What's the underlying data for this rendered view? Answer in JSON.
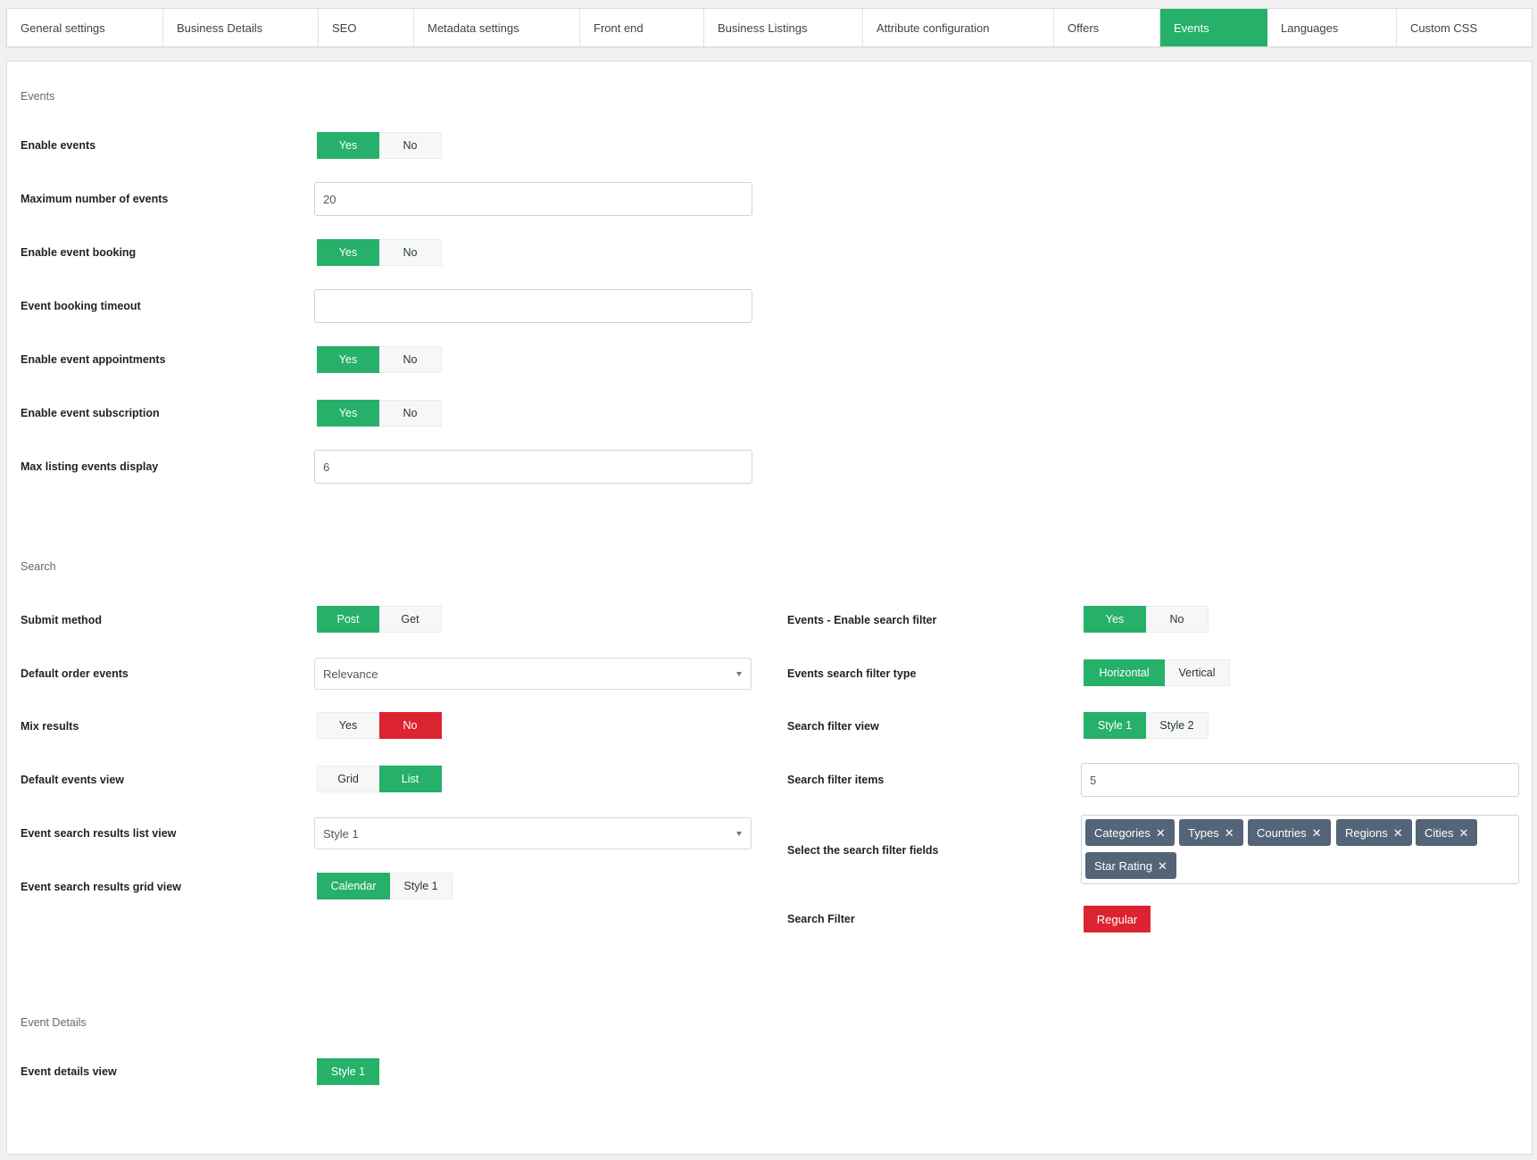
{
  "tabs": [
    {
      "label": "General settings"
    },
    {
      "label": "Business Details"
    },
    {
      "label": "SEO"
    },
    {
      "label": "Metadata settings"
    },
    {
      "label": "Front end"
    },
    {
      "label": "Business Listings"
    },
    {
      "label": "Attribute configuration"
    },
    {
      "label": "Offers"
    },
    {
      "label": "Events",
      "active": true
    },
    {
      "label": "Languages"
    },
    {
      "label": "Custom CSS"
    }
  ],
  "colors": {
    "accent": "#26b06a",
    "danger": "#dc2331",
    "tag": "#546578"
  },
  "events_section": {
    "title": "Events",
    "enable_events": {
      "label": "Enable events",
      "options": [
        "Yes",
        "No"
      ],
      "selected": "Yes"
    },
    "max_events": {
      "label": "Maximum number of events",
      "value": "20"
    },
    "enable_booking": {
      "label": "Enable event booking",
      "options": [
        "Yes",
        "No"
      ],
      "selected": "Yes"
    },
    "booking_timeout": {
      "label": "Event booking timeout",
      "value": ""
    },
    "enable_appointments": {
      "label": "Enable event appointments",
      "options": [
        "Yes",
        "No"
      ],
      "selected": "Yes"
    },
    "enable_subscription": {
      "label": "Enable event subscription",
      "options": [
        "Yes",
        "No"
      ],
      "selected": "Yes"
    },
    "max_listing_display": {
      "label": "Max listing events display",
      "value": "6"
    }
  },
  "search_section": {
    "title": "Search",
    "submit_method": {
      "label": "Submit method",
      "options": [
        "Post",
        "Get"
      ],
      "selected": "Post"
    },
    "default_order": {
      "label": "Default order events",
      "value": "Relevance"
    },
    "mix_results": {
      "label": "Mix results",
      "options": [
        "Yes",
        "No"
      ],
      "selected": "No"
    },
    "default_view": {
      "label": "Default events view",
      "options": [
        "Grid",
        "List"
      ],
      "selected": "List"
    },
    "results_list_view": {
      "label": "Event search results list view",
      "value": "Style 1"
    },
    "results_grid_view": {
      "label": "Event search results grid view",
      "options": [
        "Calendar",
        "Style 1"
      ],
      "selected": "Calendar"
    },
    "enable_search_filter": {
      "label": "Events - Enable search filter",
      "options": [
        "Yes",
        "No"
      ],
      "selected": "Yes"
    },
    "filter_type": {
      "label": "Events search filter type",
      "options": [
        "Horizontal",
        "Vertical"
      ],
      "selected": "Horizontal"
    },
    "filter_view": {
      "label": "Search filter view",
      "options": [
        "Style 1",
        "Style 2"
      ],
      "selected": "Style 1"
    },
    "filter_items": {
      "label": "Search filter items",
      "value": "5"
    },
    "filter_fields": {
      "label": "Select the search filter fields",
      "tags": [
        "Categories",
        "Types",
        "Countries",
        "Regions",
        "Cities",
        "Star Rating"
      ]
    },
    "search_filter": {
      "label": "Search Filter",
      "button": "Regular"
    }
  },
  "details_section": {
    "title": "Event Details",
    "details_view": {
      "label": "Event details view",
      "options": [
        "Style 1"
      ],
      "selected": "Style 1"
    }
  }
}
